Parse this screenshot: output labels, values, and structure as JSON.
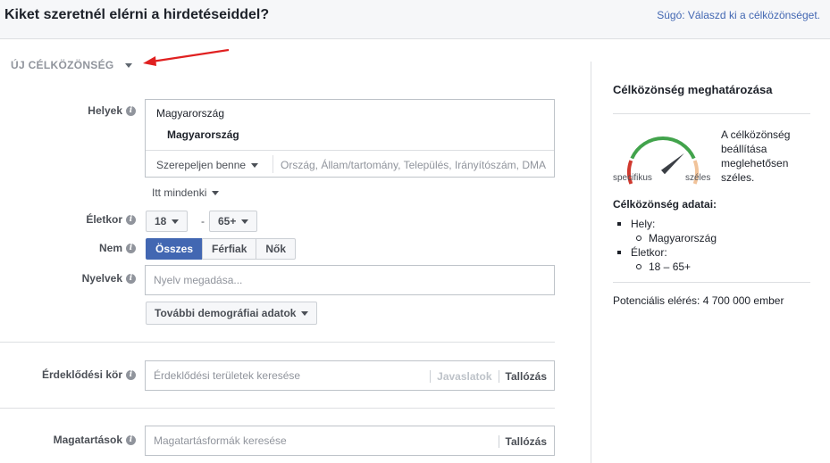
{
  "header": {
    "title": "Kiket szeretnél elérni a hirdetéseiddel?",
    "help_text": "Súgó: Válaszd ki a célközönséget."
  },
  "section": {
    "title": "ÚJ CÉLKÖZÖNSÉG"
  },
  "form": {
    "locations": {
      "label": "Helyek",
      "country": "Magyarország",
      "selected": "Magyarország",
      "mode": "Szerepeljen benne",
      "search_placeholder": "Ország, Állam/tartomány, Település, Irányítószám, DMA",
      "scope": "Itt mindenki"
    },
    "age": {
      "label": "Életkor",
      "min": "18",
      "separator": "-",
      "max": "65+"
    },
    "gender": {
      "label": "Nem",
      "options": [
        "Összes",
        "Férfiak",
        "Nők"
      ],
      "selected": "Összes"
    },
    "languages": {
      "label": "Nyelvek",
      "placeholder": "Nyelv megadása..."
    },
    "more_demographics": "További demográfiai adatok",
    "interests": {
      "label": "Érdeklődési kör",
      "placeholder": "Érdeklődési területek keresése",
      "suggestions": "Javaslatok",
      "browse": "Tallózás"
    },
    "behaviors": {
      "label": "Magatartások",
      "placeholder": "Magatartásformák keresése",
      "browse": "Tallózás"
    }
  },
  "panel": {
    "title": "Célközönség meghatározása",
    "gauge": {
      "left_label": "specifikus",
      "right_label": "széles",
      "description": "A célközönség beállítása meglehetősen széles.",
      "level": 0.72
    },
    "details_title": "Célközönség adatai:",
    "details": [
      {
        "label": "Hely:",
        "values": [
          "Magyarország"
        ]
      },
      {
        "label": "Életkor:",
        "values": [
          "18 – 65+"
        ]
      }
    ],
    "reach": "Potenciális elérés: 4 700 000 ember"
  },
  "colors": {
    "accent": "#4267b2",
    "gauge_red": "#d0392e",
    "gauge_green": "#42a34c",
    "gauge_orange": "#f1c39a",
    "annotation_arrow": "#e02020"
  }
}
